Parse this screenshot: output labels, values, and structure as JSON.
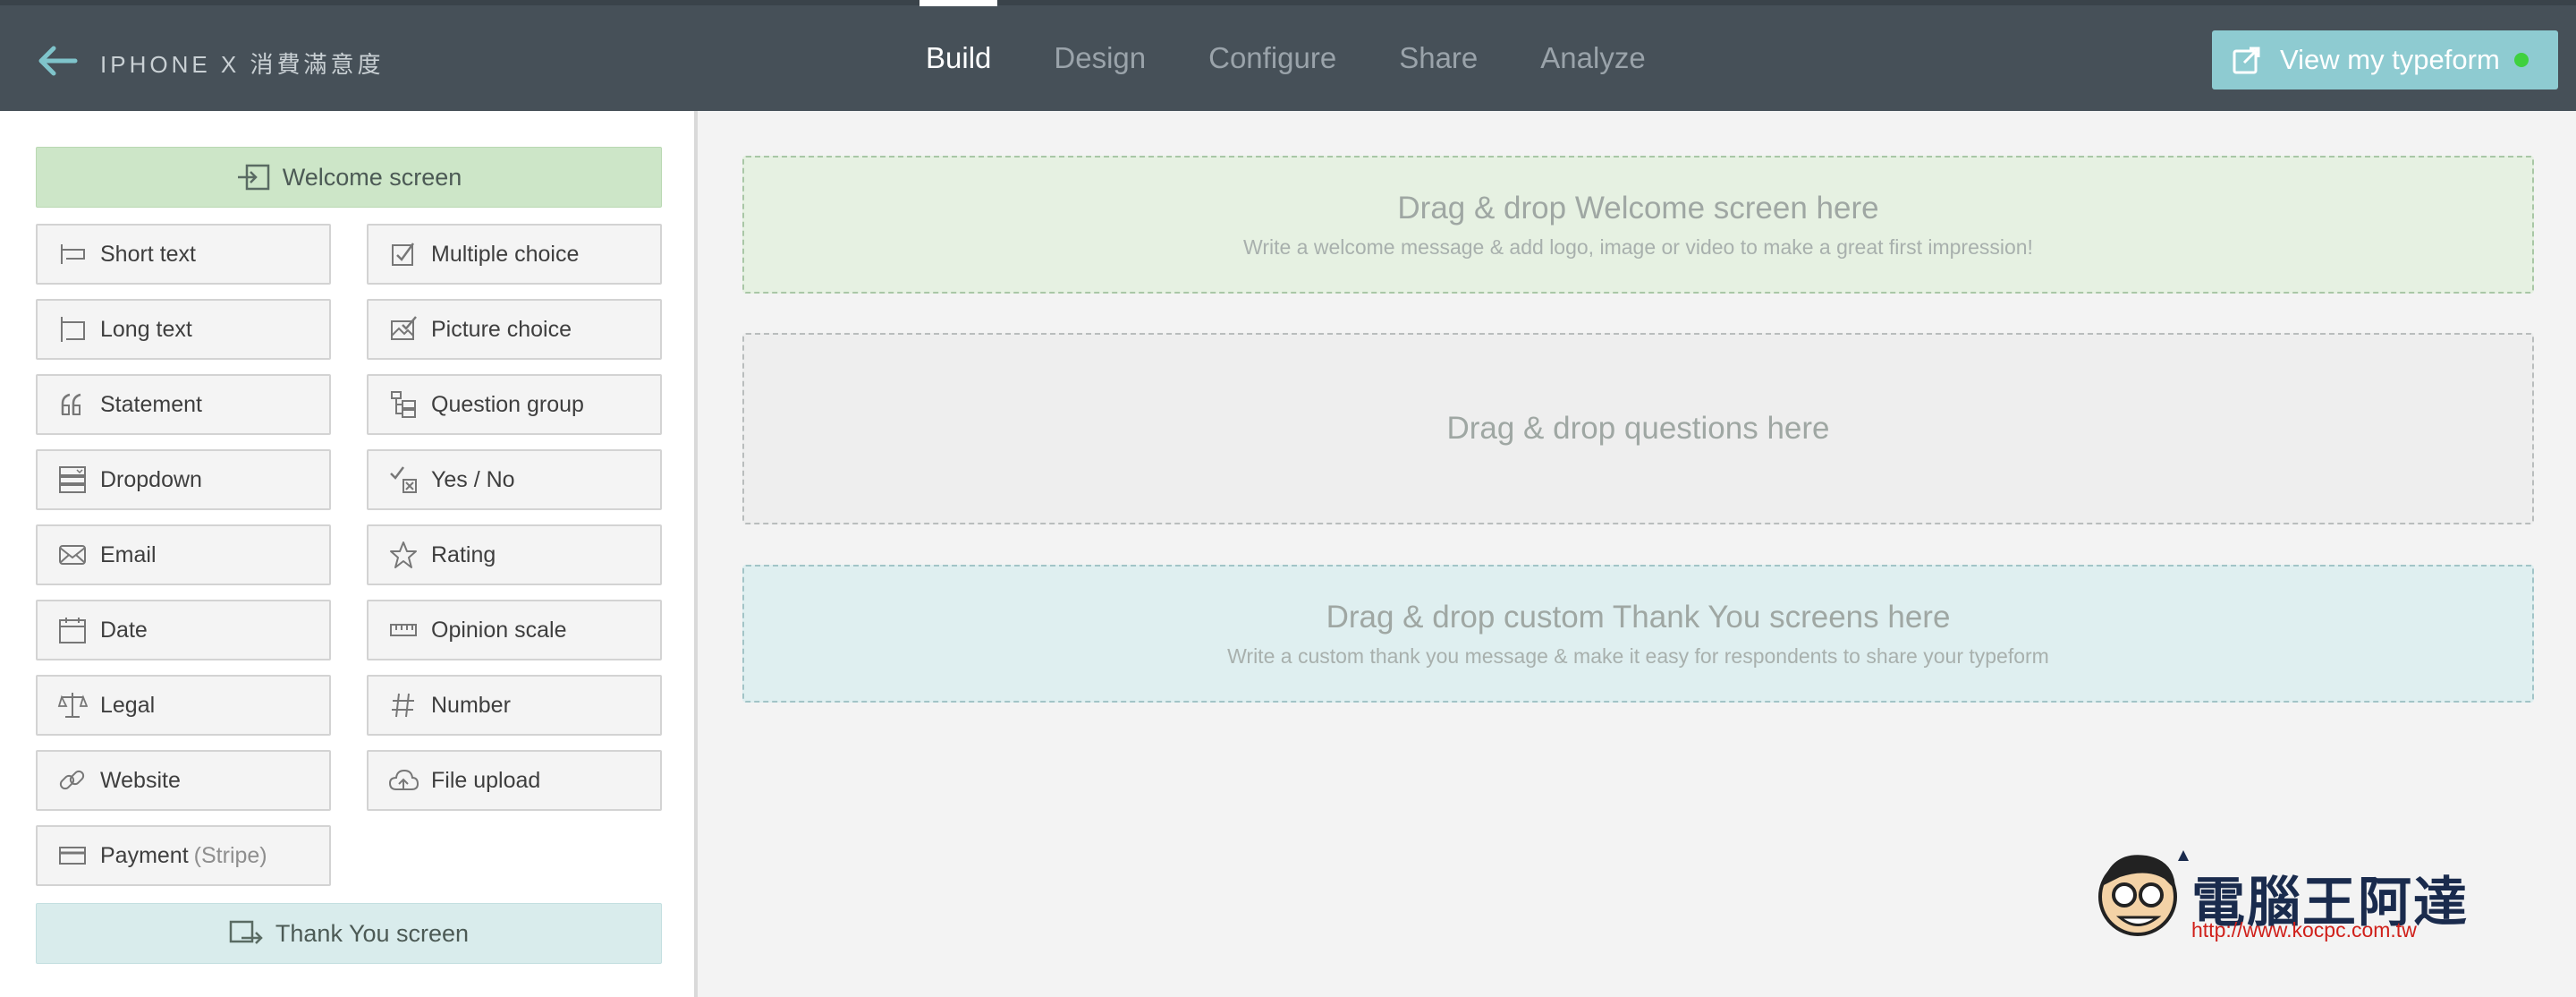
{
  "header": {
    "title": "IPHONE X 消費滿意度",
    "tabs": [
      {
        "label": "Build",
        "active": true
      },
      {
        "label": "Design",
        "active": false
      },
      {
        "label": "Configure",
        "active": false
      },
      {
        "label": "Share",
        "active": false
      },
      {
        "label": "Analyze",
        "active": false
      }
    ],
    "view_button": "View my typeform"
  },
  "sidebar": {
    "welcome_screen": "Welcome screen",
    "thank_you_screen": "Thank You screen",
    "question_types": [
      {
        "label": "Short text",
        "icon": "short-text-icon"
      },
      {
        "label": "Multiple choice",
        "icon": "multiple-choice-icon"
      },
      {
        "label": "Long text",
        "icon": "long-text-icon"
      },
      {
        "label": "Picture choice",
        "icon": "picture-choice-icon"
      },
      {
        "label": "Statement",
        "icon": "quote-icon"
      },
      {
        "label": "Question group",
        "icon": "question-group-icon"
      },
      {
        "label": "Dropdown",
        "icon": "dropdown-icon"
      },
      {
        "label": "Yes / No",
        "icon": "yes-no-icon"
      },
      {
        "label": "Email",
        "icon": "envelope-icon"
      },
      {
        "label": "Rating",
        "icon": "star-icon"
      },
      {
        "label": "Date",
        "icon": "calendar-icon"
      },
      {
        "label": "Opinion scale",
        "icon": "ruler-icon"
      },
      {
        "label": "Legal",
        "icon": "scales-icon"
      },
      {
        "label": "Number",
        "icon": "hash-icon"
      },
      {
        "label": "Website",
        "icon": "link-icon"
      },
      {
        "label": "File upload",
        "icon": "cloud-upload-icon"
      },
      {
        "label": "Payment",
        "sub": "(Stripe)",
        "icon": "credit-card-icon"
      }
    ]
  },
  "canvas": {
    "welcome_zone": {
      "title": "Drag & drop Welcome screen here",
      "subtitle": "Write a welcome message & add logo, image or video to make a great first impression!"
    },
    "questions_zone": {
      "title": "Drag & drop questions here"
    },
    "thanks_zone": {
      "title": "Drag & drop custom Thank You screens here",
      "subtitle": "Write a custom thank you message & make it easy for respondents to share your typeform"
    }
  },
  "watermark": {
    "text": "電腦王阿達",
    "url": "http://www.kocpc.com.tw"
  },
  "colors": {
    "topbar": "#465058",
    "accent": "#8ecbd1",
    "welcome": "#cde6c8",
    "thanks": "#d9ecec",
    "live": "#3fd13f"
  }
}
